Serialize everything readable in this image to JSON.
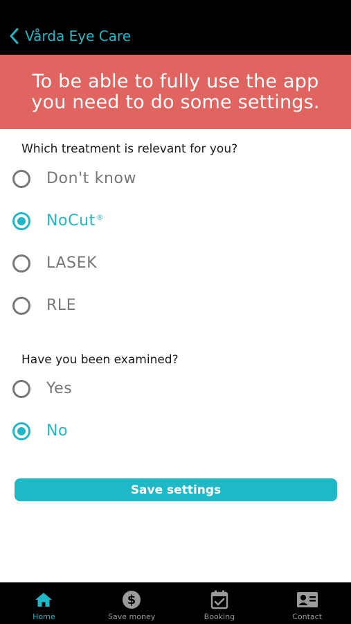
{
  "header": {
    "back_label": "Vårda Eye Care"
  },
  "banner": {
    "message": "To be able to fully use the app you need to do some settings."
  },
  "treatment": {
    "question": "Which treatment is relevant for you?",
    "options": [
      {
        "label": "Don't know",
        "selected": false
      },
      {
        "label": "NoCut",
        "trademark": "®",
        "selected": true
      },
      {
        "label": "LASEK",
        "selected": false
      },
      {
        "label": "RLE",
        "selected": false
      }
    ]
  },
  "examined": {
    "question": "Have you been examined?",
    "options": [
      {
        "label": "Yes",
        "selected": false
      },
      {
        "label": "No",
        "selected": true
      }
    ]
  },
  "save_label": "Save settings",
  "tabbar": {
    "items": [
      {
        "label": "Home",
        "icon": "home-icon",
        "active": true
      },
      {
        "label": "Save money",
        "icon": "dollar-icon",
        "active": false
      },
      {
        "label": "Booking",
        "icon": "calendar-check-icon",
        "active": false
      },
      {
        "label": "Contact",
        "icon": "contact-card-icon",
        "active": false
      }
    ]
  },
  "colors": {
    "accent": "#1fb8c7",
    "banner": "#e0645f",
    "bar": "#000000",
    "muted": "#777777"
  }
}
